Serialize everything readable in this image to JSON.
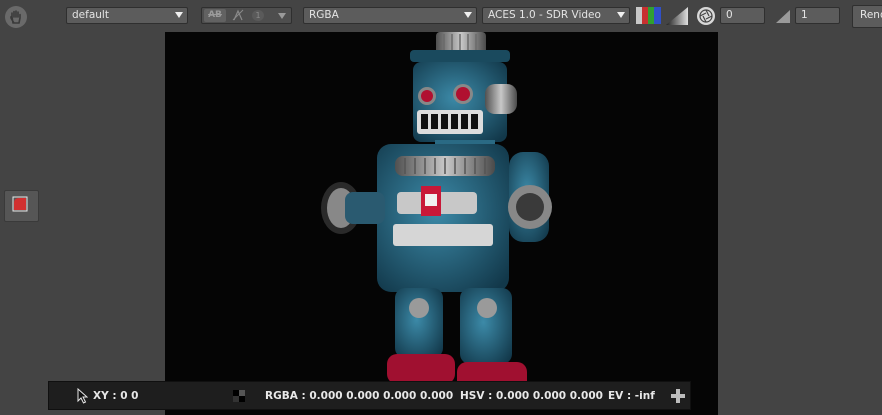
{
  "toolbar": {
    "view_combo": "default",
    "compare_ab": "AB",
    "compare_index": "1",
    "channels_combo": "RGBA",
    "display_combo": "ACES 1.0 - SDR Video",
    "exposure_value": "0",
    "gamma_value": "1",
    "render_button": "Render"
  },
  "status": {
    "xy": "XY : 0 0",
    "rgba": "RGBA : 0.000 0.000 0.000 0.000",
    "hsv": "HSV : 0.000 0.000 0.000",
    "ev": "EV : -inf"
  },
  "colors": {
    "panel_bg": "#444444",
    "viewer_bg": "#050505",
    "status_bg": "#1e1e1e",
    "robot_blue": "#2f6f8a",
    "robot_red": "#b01030"
  },
  "icons": [
    "hand-icon",
    "compare-ab-icon",
    "wipe-icon",
    "rgb-swatch-icon",
    "gamma-ramp-icon",
    "aperture-icon",
    "gamma-triangle-icon",
    "crop-icon",
    "cursor-arrow-icon",
    "add-icon"
  ]
}
